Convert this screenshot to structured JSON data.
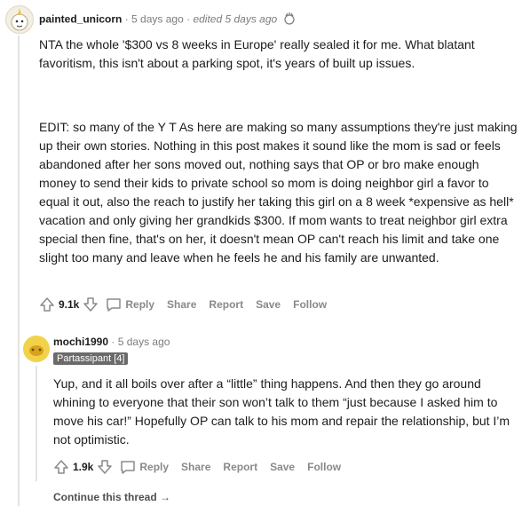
{
  "comment1": {
    "username": "painted_unicorn",
    "time": "5 days ago",
    "edited": "edited 5 days ago",
    "paragraph1": "NTA the whole '$300 vs 8 weeks in Europe' really sealed it for me. What blatant favoritism, this isn't about a parking spot, it's years of built up issues.",
    "paragraph2": "EDIT: so many of the Y T As here are making so many assumptions they're just making up their own stories. Nothing in this post makes it sound like the mom is sad or feels abandoned after her sons moved out, nothing says that OP or bro make enough money to send their kids to private school so mom is doing neighbor girl a favor to equal it out, also the reach to justify her taking this girl on a 8 week *expensive as hell* vacation and only giving her grandkids $300. If mom wants to treat neighbor girl extra special then fine, that's on her, it doesn't mean OP can't reach his limit and take one slight too many and leave when he feels he and his family are unwanted.",
    "score": "9.1k",
    "actions": {
      "reply": "Reply",
      "share": "Share",
      "report": "Report",
      "save": "Save",
      "follow": "Follow"
    }
  },
  "comment2": {
    "username": "mochi1990",
    "time": "5 days ago",
    "flair": "Partassipant [4]",
    "paragraph": "Yup, and it all boils over after a “little” thing happens. And then they go around whining to everyone that their son won’t talk to them “just because I asked him to move his car!” Hopefully OP can talk to his mom and repair the relationship, but I’m not optimistic.",
    "score": "1.9k",
    "actions": {
      "reply": "Reply",
      "share": "Share",
      "report": "Report",
      "save": "Save",
      "follow": "Follow"
    }
  },
  "continue_label": "Continue this thread →",
  "separator": "·"
}
